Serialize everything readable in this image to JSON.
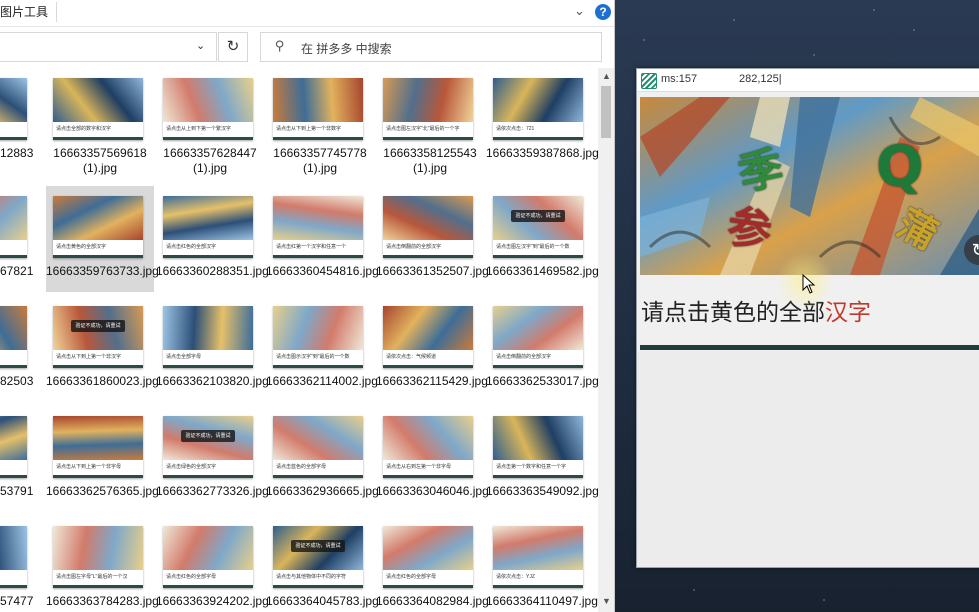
{
  "explorer": {
    "ribbon_title": "图片工具",
    "search_placeholder": "在 拼多多 中搜索",
    "refresh_glyph": "↻",
    "colors": {
      "accent_blue": "#1f6fd1",
      "selection": "#d9d9d9"
    },
    "files": [
      {
        "name": "12883",
        "caption": "",
        "accent": "#2b4a48",
        "art": "blue",
        "clipped": true
      },
      {
        "name": "16663357569618 (1).jpg",
        "caption": "请点击全部的数字和汉字",
        "accent": "#2b4a48",
        "art": "starry"
      },
      {
        "name": "16663357628447 (1).jpg",
        "caption": "请点击从上到下第一个繁汉字",
        "accent": "#2b4a48",
        "art": "pale"
      },
      {
        "name": "16663357745778 (1).jpg",
        "caption": "请点击从下到上第一个非数字",
        "accent": "#2b4a48",
        "art": "warm"
      },
      {
        "name": "16663358125543 (1).jpg",
        "caption": "请点击图左汉字\"北\"最后的一个字",
        "accent": "#2b4a48",
        "art": "warm2"
      },
      {
        "name": "16663359387868.jpg",
        "caption": "请依次点击：721",
        "accent": "#2b4a48",
        "art": "starry"
      },
      {
        "name": "67821",
        "caption": "",
        "accent": "#2b4a48",
        "art": "pale",
        "clipped": true
      },
      {
        "name": "16663359763733.jpg",
        "caption": "请点击黄色的全部汉字",
        "accent": "#2b4a48",
        "art": "warm",
        "selected": true
      },
      {
        "name": "16663360288351.jpg",
        "caption": "请点击红色的全部汉字",
        "accent": "#2b4a48",
        "art": "blue"
      },
      {
        "name": "16663360454816.jpg",
        "caption": "请点击红第一个汉字和任意一个",
        "accent": "#2b4a48",
        "art": "pale"
      },
      {
        "name": "16663361352507.jpg",
        "caption": "请点击倒翻前的全部汉字",
        "accent": "#2b4a48",
        "art": "warm2"
      },
      {
        "name": "16663361469582.jpg",
        "caption": "请点击图左汉字\"到\"最后的一个数",
        "accent": "#2b4a48",
        "art": "pale",
        "toast": true
      },
      {
        "name": "82503",
        "caption": "",
        "accent": "#2b4a48",
        "art": "warm",
        "clipped": true
      },
      {
        "name": "16663361860023.jpg",
        "caption": "请点击从下到上第一个非汉字",
        "accent": "#2b4a48",
        "art": "warm2",
        "toast": true
      },
      {
        "name": "16663362103820.jpg",
        "caption": "请点击全部字母",
        "accent": "#2b4a48",
        "art": "blue"
      },
      {
        "name": "16663362114002.jpg",
        "caption": "请点击图示汉字\"到\"最后的一个数",
        "accent": "#2b4a48",
        "art": "pale"
      },
      {
        "name": "16663362115429.jpg",
        "caption": "请依次点击：气候频道",
        "accent": "#2b4a48",
        "art": "warm"
      },
      {
        "name": "16663362533017.jpg",
        "caption": "请点击倒翻前的全部汉字",
        "accent": "#2b4a48",
        "art": "pale"
      },
      {
        "name": "53791",
        "caption": "",
        "accent": "#2b4a48",
        "art": "blue",
        "clipped": true
      },
      {
        "name": "16663362576365.jpg",
        "caption": "请点击从下到上第一个非字母",
        "accent": "#2b4a48",
        "art": "warm"
      },
      {
        "name": "16663362773326.jpg",
        "caption": "请点击绿色的全部汉字",
        "accent": "#2b4a48",
        "art": "pale",
        "toast": true
      },
      {
        "name": "16663362936665.jpg",
        "caption": "请点击蓝色的全部字母",
        "accent": "#2b4a48",
        "art": "pale"
      },
      {
        "name": "16663363046046.jpg",
        "caption": "请点击从右到左第一个非字母",
        "accent": "#2b4a48",
        "art": "pale"
      },
      {
        "name": "16663363549092.jpg",
        "caption": "请点击第一个数字和任意一个字",
        "accent": "#2b4a48",
        "art": "starry"
      },
      {
        "name": "57477",
        "caption": "",
        "accent": "#2b4a48",
        "art": "blue",
        "clipped": true
      },
      {
        "name": "16663363784283.jpg",
        "caption": "请点击图左字母\"L\"最后的一个汉",
        "accent": "#2b4a48",
        "art": "pale"
      },
      {
        "name": "16663363924202.jpg",
        "caption": "请点击红色的全部字母",
        "accent": "#2b4a48",
        "art": "pale"
      },
      {
        "name": "16663364045783.jpg",
        "caption": "请点击与其他物体中不同的字符",
        "accent": "#2b4a48",
        "art": "starry",
        "toast": true
      },
      {
        "name": "16663364082984.jpg",
        "caption": "请点击红色的全部字母",
        "accent": "#2b4a48",
        "art": "pale"
      },
      {
        "name": "16663364110497.jpg",
        "caption": "请依次点击：YJZ",
        "accent": "#2b4a48",
        "art": "pale"
      }
    ],
    "toast_text": "验证不成功，请重试"
  },
  "viewer": {
    "ms_label": "ms:157",
    "coord_label": "282,125|",
    "caption_prefix": "请点击黄色的全部",
    "caption_highlight": "汉字",
    "highlight_color": "#c0392b",
    "image_chars": [
      {
        "char": "季",
        "color": "#2f8a3a"
      },
      {
        "char": "参",
        "color": "#a52a2a"
      },
      {
        "char": "Q",
        "color": "#1f7a3a"
      },
      {
        "char": "蒲",
        "color": "#c9a227"
      }
    ]
  }
}
